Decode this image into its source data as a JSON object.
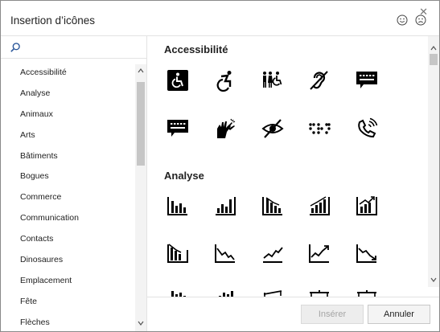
{
  "dialog": {
    "title": "Insertion d’icônes",
    "close_glyph": "✕"
  },
  "search": {
    "icon": "search-icon"
  },
  "categories": [
    "Accessibilité",
    "Analyse",
    "Animaux",
    "Arts",
    "Bâtiments",
    "Bogues",
    "Commerce",
    "Communication",
    "Contacts",
    "Dinosaures",
    "Emplacement",
    "Fête",
    "Flèches"
  ],
  "sections": [
    {
      "title": "Accessibilité",
      "icons": [
        "wheelchair-accessible-icon",
        "wheelchair-active-icon",
        "family-accessibility-icon",
        "hearing-impaired-icon",
        "tty-message-icon",
        "captioning-icon",
        "sign-language-icon",
        "low-vision-icon",
        "braille-icon",
        "phone-volume-icon"
      ]
    },
    {
      "title": "Analyse",
      "icons": [
        "bar-chart-icon",
        "bar-chart-rising-icon",
        "bar-chart-falling-icon",
        "bar-chart-trend-up-icon",
        "bar-chart-arrow-up-icon",
        "bar-chart-arrow-down-icon",
        "line-downtrend-icon",
        "line-uptrend-icon",
        "line-uptrend-arrow-icon",
        "line-downtrend-arrow-icon"
      ]
    }
  ],
  "buttons": {
    "insert": "Insérer",
    "cancel": "Annuler"
  },
  "colors": {
    "accent": "#2b579a",
    "icon": "#000000",
    "border": "#8a8a8a"
  }
}
